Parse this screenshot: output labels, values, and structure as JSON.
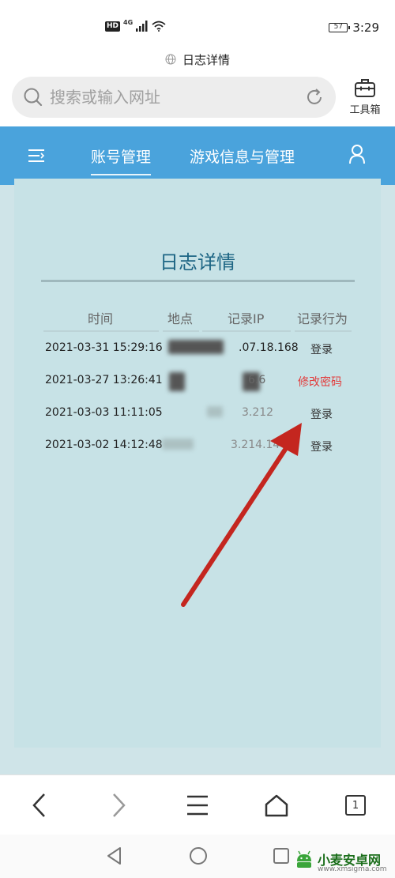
{
  "status_bar": {
    "network_badge": "HD",
    "network_type": "4G",
    "battery": "57",
    "time": "3:29"
  },
  "browser": {
    "page_title": "日志详情",
    "search_placeholder": "搜索或输入网址",
    "toolbox_label": "工具箱",
    "tab_count": "1"
  },
  "site_nav": {
    "tabs": [
      {
        "label": "账号管理",
        "active": true
      },
      {
        "label": "游戏信息与管理",
        "active": false
      }
    ],
    "accent_color": "#4aa3dc"
  },
  "log": {
    "heading": "日志详情",
    "columns": [
      "时间",
      "地点",
      "记录IP",
      "记录行为"
    ],
    "rows": [
      {
        "time": "2021-03-31 15:29:16",
        "location": "",
        "ip": ".07.18.168",
        "action": "登录"
      },
      {
        "time": "2021-03-27 13:26:41",
        "location": "",
        "ip": "6.6",
        "action": "修改密码"
      },
      {
        "time": "2021-03-03 11:11:05",
        "location": "",
        "ip": "3.212",
        "action": "登录"
      },
      {
        "time": "2021-03-02 14:12:48",
        "location": "",
        "ip": "3.214.14",
        "action": "登录"
      }
    ],
    "highlight_color": "#e23b3b"
  },
  "watermark": {
    "text": "小麦安卓网",
    "url": "www.xmsigma.com"
  }
}
